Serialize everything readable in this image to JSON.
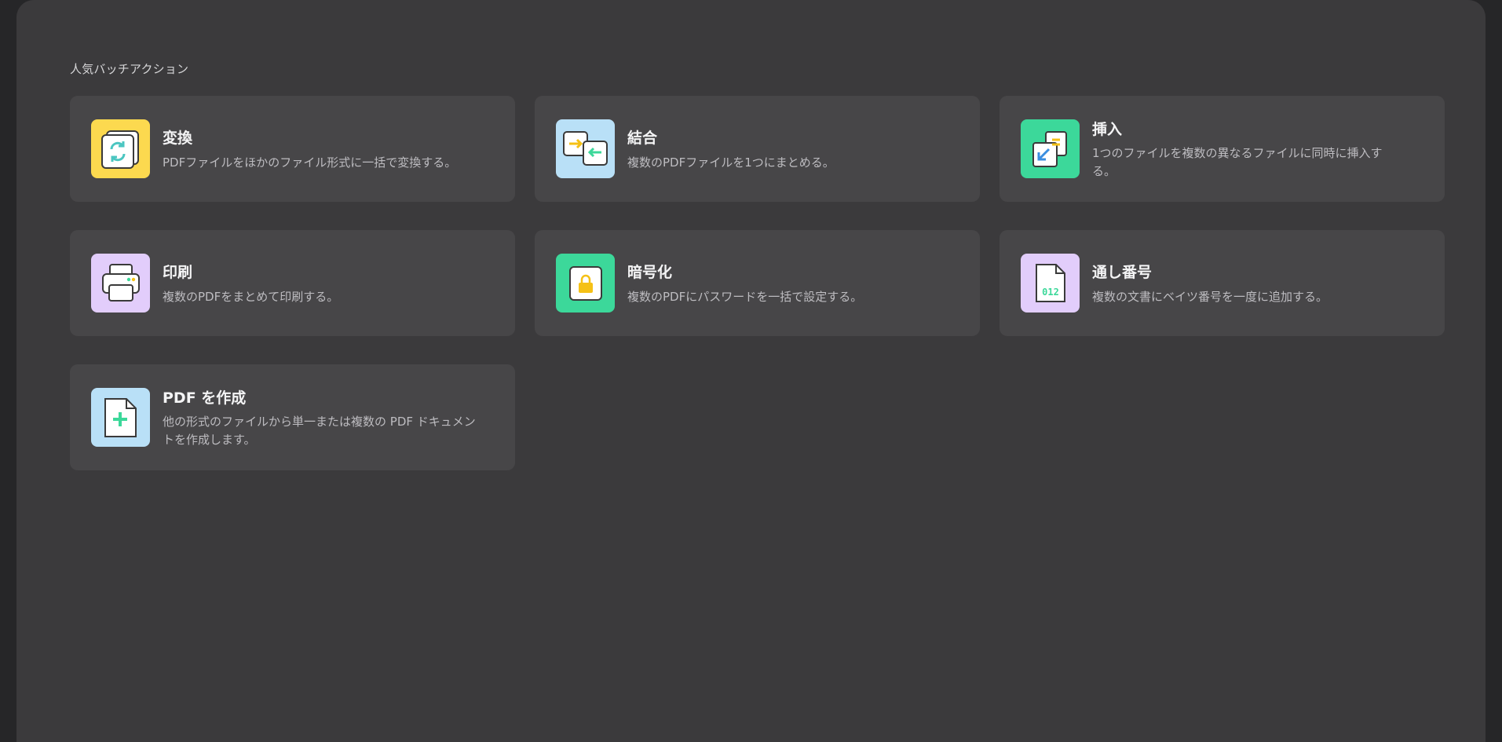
{
  "section": {
    "title": "人気バッチアクション"
  },
  "actions": [
    {
      "title": "変換",
      "description": "PDFファイルをほかのファイル形式に一括で変換する。",
      "icon": "convert-icon",
      "color": "#fcd94f"
    },
    {
      "title": "結合",
      "description": "複数のPDFファイルを1つにまとめる。",
      "icon": "merge-icon",
      "color": "#b9e0f7"
    },
    {
      "title": "挿入",
      "description": "1つのファイルを複数の異なるファイルに同時に挿入する。",
      "icon": "insert-icon",
      "color": "#3cd89a"
    },
    {
      "title": "印刷",
      "description": "複数のPDFをまとめて印刷する。",
      "icon": "print-icon",
      "color": "#e2cdfb"
    },
    {
      "title": "暗号化",
      "description": "複数のPDFにパスワードを一括で設定する。",
      "icon": "lock-icon",
      "color": "#3cd89a"
    },
    {
      "title": "通し番号",
      "description": "複数の文書にベイツ番号を一度に追加する。",
      "icon": "bates-number-icon",
      "color": "#e2cdfb",
      "icon_text": "012"
    },
    {
      "title": "PDF を作成",
      "description": "他の形式のファイルから単一または複数の PDF ドキュメントを作成します。",
      "icon": "create-pdf-icon",
      "color": "#b9e0f7"
    }
  ]
}
